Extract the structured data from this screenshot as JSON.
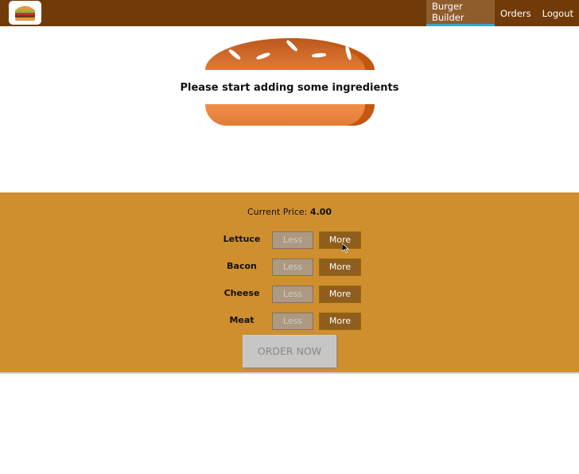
{
  "nav": {
    "items": [
      {
        "label": "Burger Builder",
        "active": true
      },
      {
        "label": "Orders",
        "active": false
      },
      {
        "label": "Logout",
        "active": false
      }
    ]
  },
  "burger": {
    "message": "Please start adding some ingredients"
  },
  "controls": {
    "price_label": "Current Price:",
    "price_value": "4.00",
    "less_label": "Less",
    "more_label": "More",
    "ingredients": [
      {
        "label": "Lettuce"
      },
      {
        "label": "Bacon"
      },
      {
        "label": "Cheese"
      },
      {
        "label": "Meat"
      }
    ],
    "order_label": "ORDER NOW"
  },
  "colors": {
    "toolbar": "#703b09",
    "controls_bg": "#cf8f2e",
    "more_button": "#8f5e1e",
    "active_underline": "#40a4c8"
  }
}
